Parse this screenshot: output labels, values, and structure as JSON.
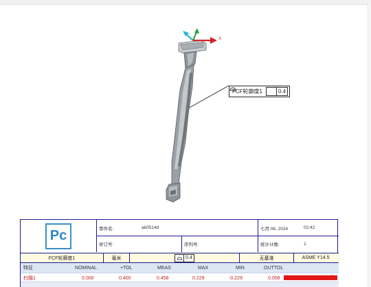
{
  "viewport": {
    "axis_x_label": "X",
    "callout": {
      "feature_name": "FCF轮廓度1",
      "tolerance": "0.4",
      "symbol": "profile-of-surface-icon"
    }
  },
  "report": {
    "logo_text": "Pc",
    "part_name_label": "零件名:",
    "part_name_value": "ab0514d",
    "date_value": "七月 06, 2024",
    "time_value": "02:42",
    "revision_label": "修订号:",
    "serial_label": "序列号:",
    "stats_label": "统计计数:",
    "stats_value": "1",
    "fcf_name": "FCF轮廓度1",
    "units": "毫米",
    "tolerance": "0.4",
    "datum": "无基准",
    "standard": "ASME Y14.5",
    "columns": [
      "特征",
      "NOMINAL",
      "+TOL",
      "MEAS",
      "MAX",
      "MIN",
      "OUTTOL"
    ],
    "row": {
      "feature": "扫描1",
      "nominal": "0.000",
      "tol": "0.400",
      "meas": "0.458",
      "max": "0.229",
      "min": "-0.229",
      "outtol": "0.058"
    }
  },
  "colors": {
    "border": "#1c1a8c",
    "header_bg": "#dce6f4",
    "out_of_tol": "#e01818",
    "fcf_row_bg": "#fffbe0"
  }
}
